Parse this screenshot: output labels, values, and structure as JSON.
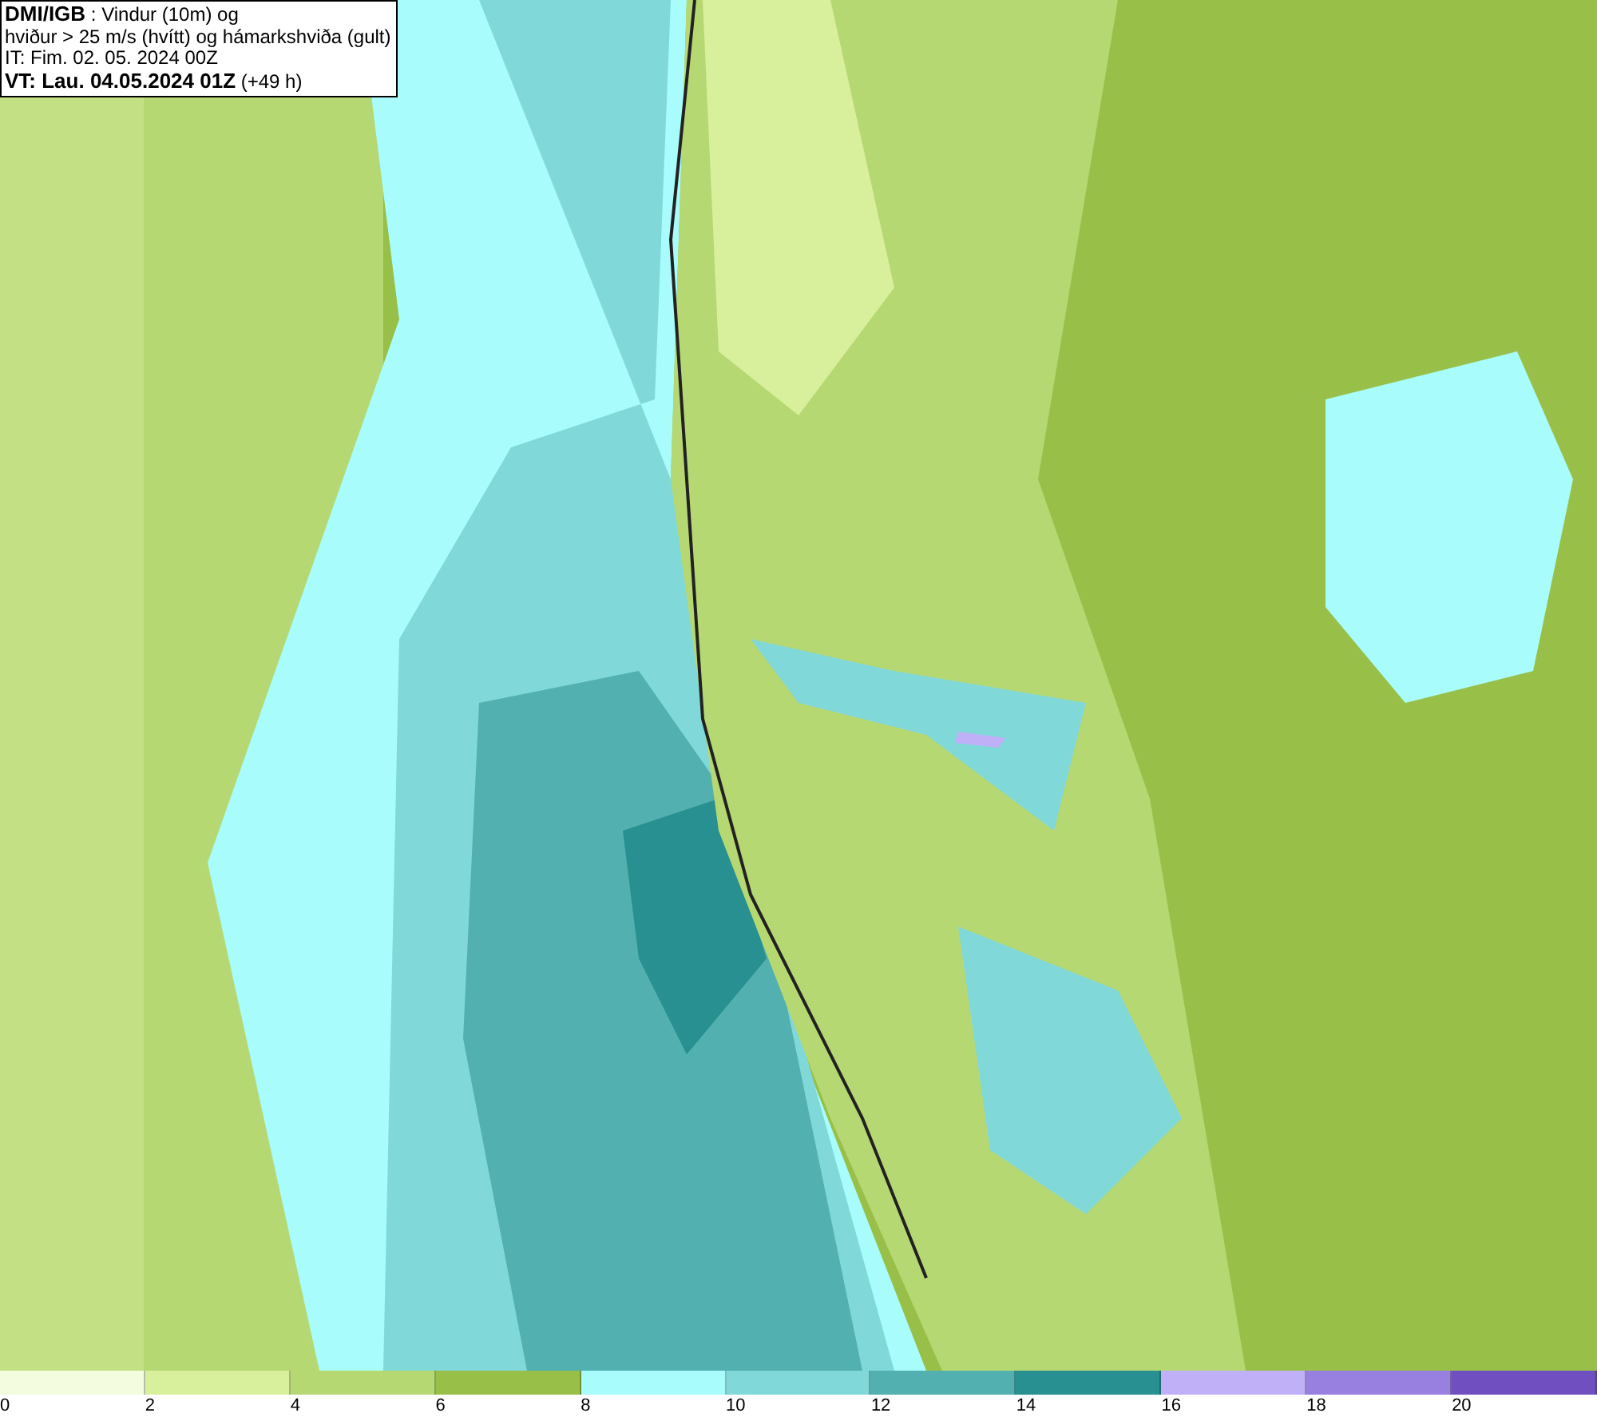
{
  "title_box": {
    "lines": [
      "**DMI/IGB** : Vindur (10m) og",
      "hviður > 25 m/s (hvítt) og hámarkshviða (gult)",
      "IT: Fim. 02. 05. 2024 00Z",
      "**VT: Lau. 04.05.2024 01Z** (+49 h)"
    ]
  },
  "legend": [
    {
      "label": "0",
      "color": "#f4fce0"
    },
    {
      "label": "2",
      "color": "#d8f09c"
    },
    {
      "label": "4",
      "color": "#b6d872"
    },
    {
      "label": "6",
      "color": "#98c048"
    },
    {
      "label": "8",
      "color": "#a8fcfc"
    },
    {
      "label": "10",
      "color": "#80d8d8"
    },
    {
      "label": "12",
      "color": "#52b0b0"
    },
    {
      "label": "14",
      "color": "#289090"
    },
    {
      "label": "16",
      "color": "#c0b0f8"
    },
    {
      "label": "18",
      "color": "#9880e0"
    },
    {
      "label": "20",
      "color": "#7050c0"
    }
  ]
}
